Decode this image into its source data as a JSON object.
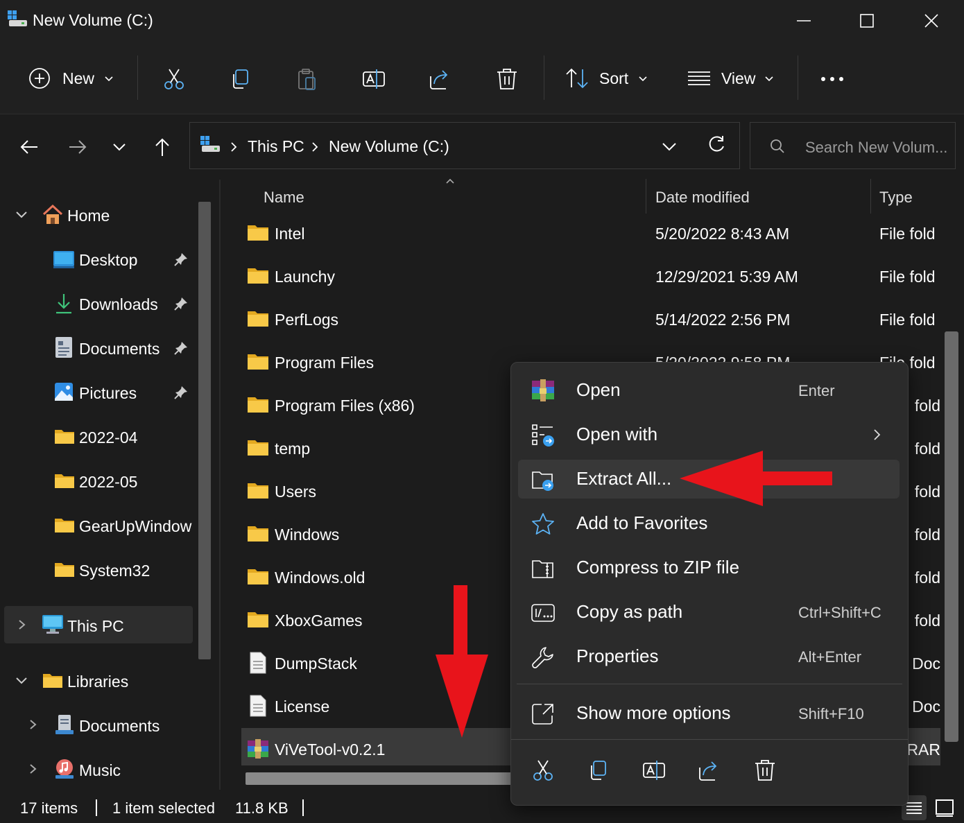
{
  "window": {
    "title": "New Volume (C:)"
  },
  "toolbar": {
    "new_label": "New",
    "sort_label": "Sort",
    "view_label": "View"
  },
  "address": {
    "crumbs": [
      "This PC",
      "New Volume (C:)"
    ],
    "search_placeholder": "Search New Volum..."
  },
  "sidebar": {
    "home": "Home",
    "quick": [
      {
        "label": "Desktop",
        "pinned": true
      },
      {
        "label": "Downloads",
        "pinned": true
      },
      {
        "label": "Documents",
        "pinned": true
      },
      {
        "label": "Pictures",
        "pinned": true
      },
      {
        "label": "2022-04"
      },
      {
        "label": "2022-05"
      },
      {
        "label": "GearUpWindow"
      },
      {
        "label": "System32"
      }
    ],
    "this_pc": "This PC",
    "libraries": "Libraries",
    "lib_items": [
      "Documents",
      "Music"
    ]
  },
  "filelist": {
    "headers": {
      "name": "Name",
      "date": "Date modified",
      "type": "Type"
    },
    "rows": [
      {
        "name": "Intel",
        "date": "5/20/2022 8:43 AM",
        "type": "File fold",
        "icon": "folder"
      },
      {
        "name": "Launchy",
        "date": "12/29/2021 5:39 AM",
        "type": "File fold",
        "icon": "folder"
      },
      {
        "name": "PerfLogs",
        "date": "5/14/2022 2:56 PM",
        "type": "File fold",
        "icon": "folder"
      },
      {
        "name": "Program Files",
        "date": "5/20/2022 9:58 PM",
        "type": "File fold",
        "icon": "folder"
      },
      {
        "name": "Program Files (x86)",
        "date": "",
        "type": "fold",
        "icon": "folder"
      },
      {
        "name": "temp",
        "date": "",
        "type": "fold",
        "icon": "folder"
      },
      {
        "name": "Users",
        "date": "",
        "type": "fold",
        "icon": "folder"
      },
      {
        "name": "Windows",
        "date": "",
        "type": "fold",
        "icon": "folder"
      },
      {
        "name": "Windows.old",
        "date": "",
        "type": "fold",
        "icon": "folder"
      },
      {
        "name": "XboxGames",
        "date": "",
        "type": "fold",
        "icon": "folder"
      },
      {
        "name": "DumpStack",
        "date": "",
        "type": ": Doc",
        "icon": "document"
      },
      {
        "name": "License",
        "date": "",
        "type": ": Doc",
        "icon": "document"
      },
      {
        "name": "ViVeTool-v0.2.1",
        "date": "",
        "type": "RAR",
        "icon": "winrar",
        "selected": true
      }
    ]
  },
  "context_menu": {
    "items": [
      {
        "label": "Open",
        "shortcut": "Enter",
        "icon": "winrar-icon"
      },
      {
        "label": "Open with",
        "shortcut": "",
        "icon": "open-with-icon",
        "submenu": true
      },
      {
        "label": "Extract All...",
        "shortcut": "",
        "icon": "extract-folder-icon",
        "highlighted": true
      },
      {
        "label": "Add to Favorites",
        "shortcut": "",
        "icon": "star-icon"
      },
      {
        "label": "Compress to ZIP file",
        "shortcut": "",
        "icon": "zip-folder-icon"
      },
      {
        "label": "Copy as path",
        "shortcut": "Ctrl+Shift+C",
        "icon": "copy-path-icon"
      },
      {
        "label": "Properties",
        "shortcut": "Alt+Enter",
        "icon": "wrench-icon"
      },
      {
        "label": "Show more options",
        "shortcut": "Shift+F10",
        "icon": "more-options-icon"
      }
    ]
  },
  "status": {
    "count": "17 items",
    "selected": "1 item selected",
    "size": "11.8 KB"
  },
  "colors": {
    "accent_arrow": "#e8141b",
    "folder": "#f8c948",
    "background": "#1c1c1c",
    "menu": "#2b2b2b",
    "highlight": "#383838"
  }
}
